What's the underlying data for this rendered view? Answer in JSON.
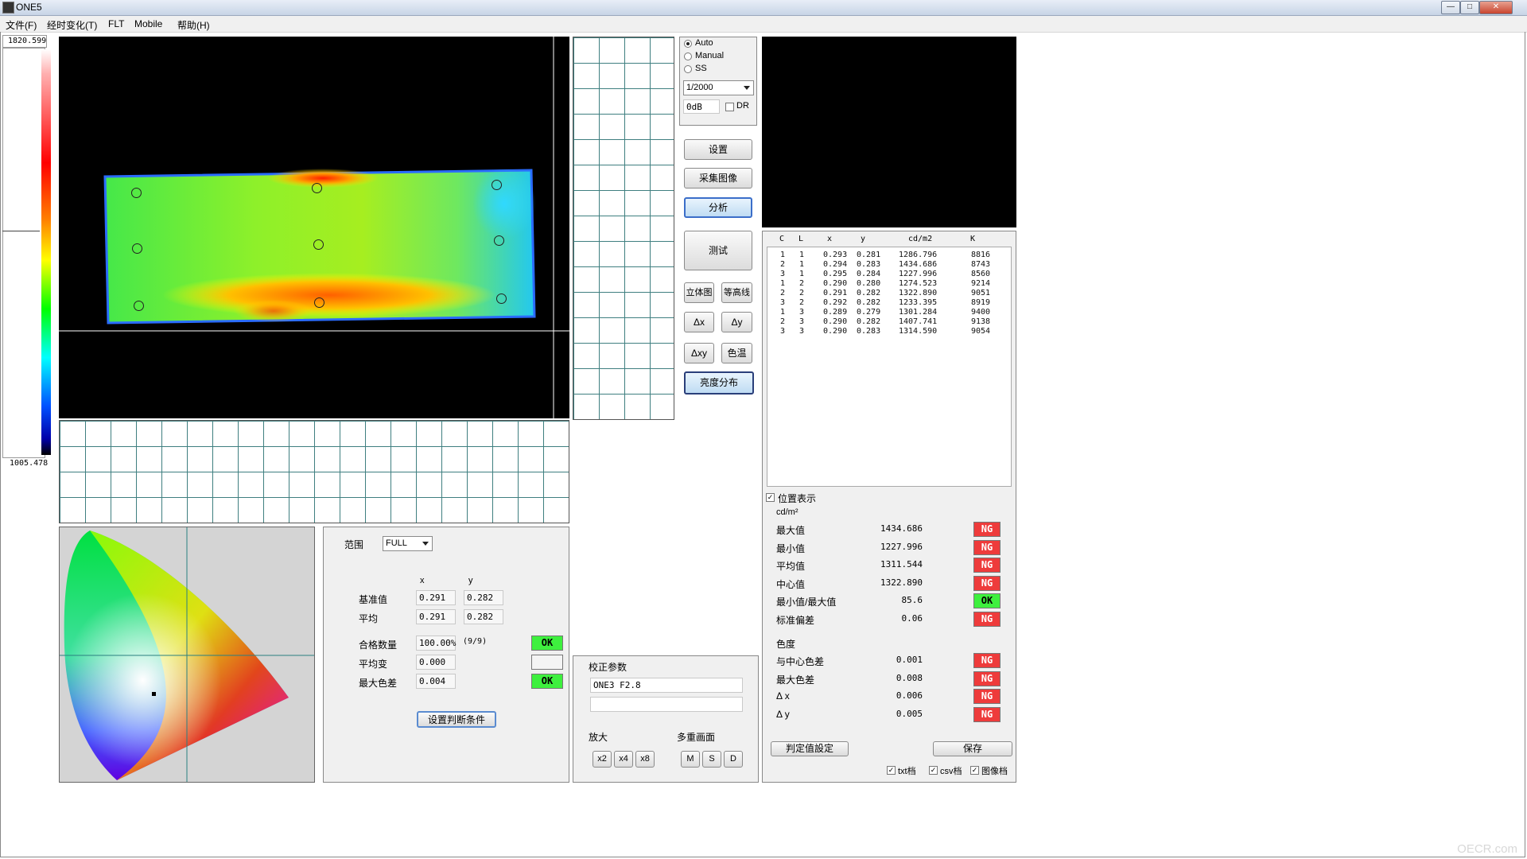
{
  "window": {
    "title": "ONE5",
    "btn_min": "—",
    "btn_max": "□",
    "btn_close": "✕"
  },
  "menu": [
    "文件(F)",
    "经时变化(T)",
    "FLT",
    "Mobile",
    "帮助(H)"
  ],
  "colorbar": {
    "max": "1820.599",
    "min": "1005.478"
  },
  "capture": {
    "mode_options": [
      {
        "label": "Auto",
        "selected": true
      },
      {
        "label": "Manual",
        "selected": false
      },
      {
        "label": "SS",
        "selected": false
      }
    ],
    "shutter": "1/2000",
    "gain": "0dB",
    "dr_label": "DR"
  },
  "buttons": {
    "settings": "设置",
    "capture": "采集图像",
    "analyze": "分析",
    "measure": "测试",
    "view3d": "立体图",
    "contour": "等高线",
    "dx": "Δx",
    "dy": "Δy",
    "dxy": "Δxy",
    "colortemp": "色温",
    "luminance": "亮度分布"
  },
  "table": {
    "headers": [
      "C",
      "L",
      "x",
      "y",
      "cd/m2",
      "K"
    ],
    "rows": [
      [
        "1",
        "1",
        "0.293",
        "0.281",
        "1286.796",
        "8816"
      ],
      [
        "2",
        "1",
        "0.294",
        "0.283",
        "1434.686",
        "8743"
      ],
      [
        "3",
        "1",
        "0.295",
        "0.284",
        "1227.996",
        "8560"
      ],
      [
        "1",
        "2",
        "0.290",
        "0.280",
        "1274.523",
        "9214"
      ],
      [
        "2",
        "2",
        "0.291",
        "0.282",
        "1322.890",
        "9051"
      ],
      [
        "3",
        "2",
        "0.292",
        "0.282",
        "1233.395",
        "8919"
      ],
      [
        "1",
        "3",
        "0.289",
        "0.279",
        "1301.284",
        "9400"
      ],
      [
        "2",
        "3",
        "0.290",
        "0.282",
        "1407.741",
        "9138"
      ],
      [
        "3",
        "3",
        "0.290",
        "0.283",
        "1314.590",
        "9054"
      ]
    ]
  },
  "stats": {
    "show_position": "位置表示",
    "unit": "cd/m²",
    "items": [
      {
        "label": "最大值",
        "value": "1434.686",
        "status": "NG"
      },
      {
        "label": "最小值",
        "value": "1227.996",
        "status": "NG"
      },
      {
        "label": "平均值",
        "value": "1311.544",
        "status": "NG"
      },
      {
        "label": "中心值",
        "value": "1322.890",
        "status": "NG"
      },
      {
        "label": "最小值/最大值",
        "value": "85.6",
        "status": "OK"
      },
      {
        "label": "标准偏差",
        "value": "0.06",
        "status": "NG"
      }
    ],
    "chroma_title": "色度",
    "chroma_items": [
      {
        "label": "与中心色差",
        "value": "0.001",
        "status": "NG"
      },
      {
        "label": "最大色差",
        "value": "0.008",
        "status": "NG"
      },
      {
        "label": "Δ x",
        "value": "0.006",
        "status": "NG"
      },
      {
        "label": "Δ y",
        "value": "0.005",
        "status": "NG"
      }
    ],
    "judge_button": "判定值設定",
    "save_button": "保存",
    "save_opts": [
      "txt档",
      "csv档",
      "图像档"
    ]
  },
  "analysis": {
    "range_label": "范围",
    "range_value": "FULL",
    "col_x": "x",
    "col_y": "y",
    "base_label": "基准值",
    "base_x": "0.291",
    "base_y": "0.282",
    "avg_label": "平均",
    "avg_x": "0.291",
    "avg_y": "0.282",
    "pass_label": "合格数量",
    "pass_value": "100.00%",
    "pass_count": "(9/9)",
    "pass_status": "OK",
    "avgvar_label": "平均变",
    "avgvar_value": "0.000",
    "maxdiff_label": "最大色差",
    "maxdiff_value": "0.004",
    "maxdiff_status": "OK",
    "set_cond_button": "设置判断条件"
  },
  "calib": {
    "title": "校正参数",
    "value": "ONE3 F2.8",
    "zoom_label": "放大",
    "zoom_buttons": [
      "x2",
      "x4",
      "x8"
    ],
    "multi_label": "多重画面",
    "multi_buttons": [
      "M",
      "S",
      "D"
    ]
  },
  "watermark": "OECR.com",
  "colors": {
    "ng": "#ee3b3b",
    "ok": "#3ef03e",
    "grid_line": "#3f7f80",
    "selected_border": "#3b6ec9"
  }
}
